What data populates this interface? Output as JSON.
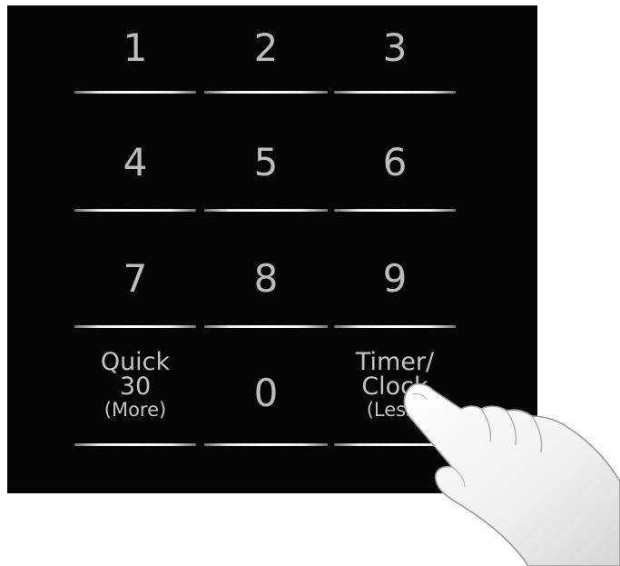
{
  "keypad": {
    "keys": [
      {
        "id": "1",
        "lines": [
          "1"
        ]
      },
      {
        "id": "2",
        "lines": [
          "2"
        ]
      },
      {
        "id": "3",
        "lines": [
          "3"
        ]
      },
      {
        "id": "4",
        "lines": [
          "4"
        ]
      },
      {
        "id": "5",
        "lines": [
          "5"
        ]
      },
      {
        "id": "6",
        "lines": [
          "6"
        ]
      },
      {
        "id": "7",
        "lines": [
          "7"
        ]
      },
      {
        "id": "8",
        "lines": [
          "8"
        ]
      },
      {
        "id": "9",
        "lines": [
          "9"
        ]
      },
      {
        "id": "quick30",
        "lines": [
          "Quick",
          "30",
          "(More)"
        ]
      },
      {
        "id": "0",
        "lines": [
          "0"
        ]
      },
      {
        "id": "timer",
        "lines": [
          "Timer/",
          "Clock",
          "(Less)"
        ]
      }
    ]
  },
  "colors": {
    "panel": "#050505",
    "text": "#c4c4c4",
    "line": "#ffffff",
    "hand": "#f2f2f2"
  }
}
